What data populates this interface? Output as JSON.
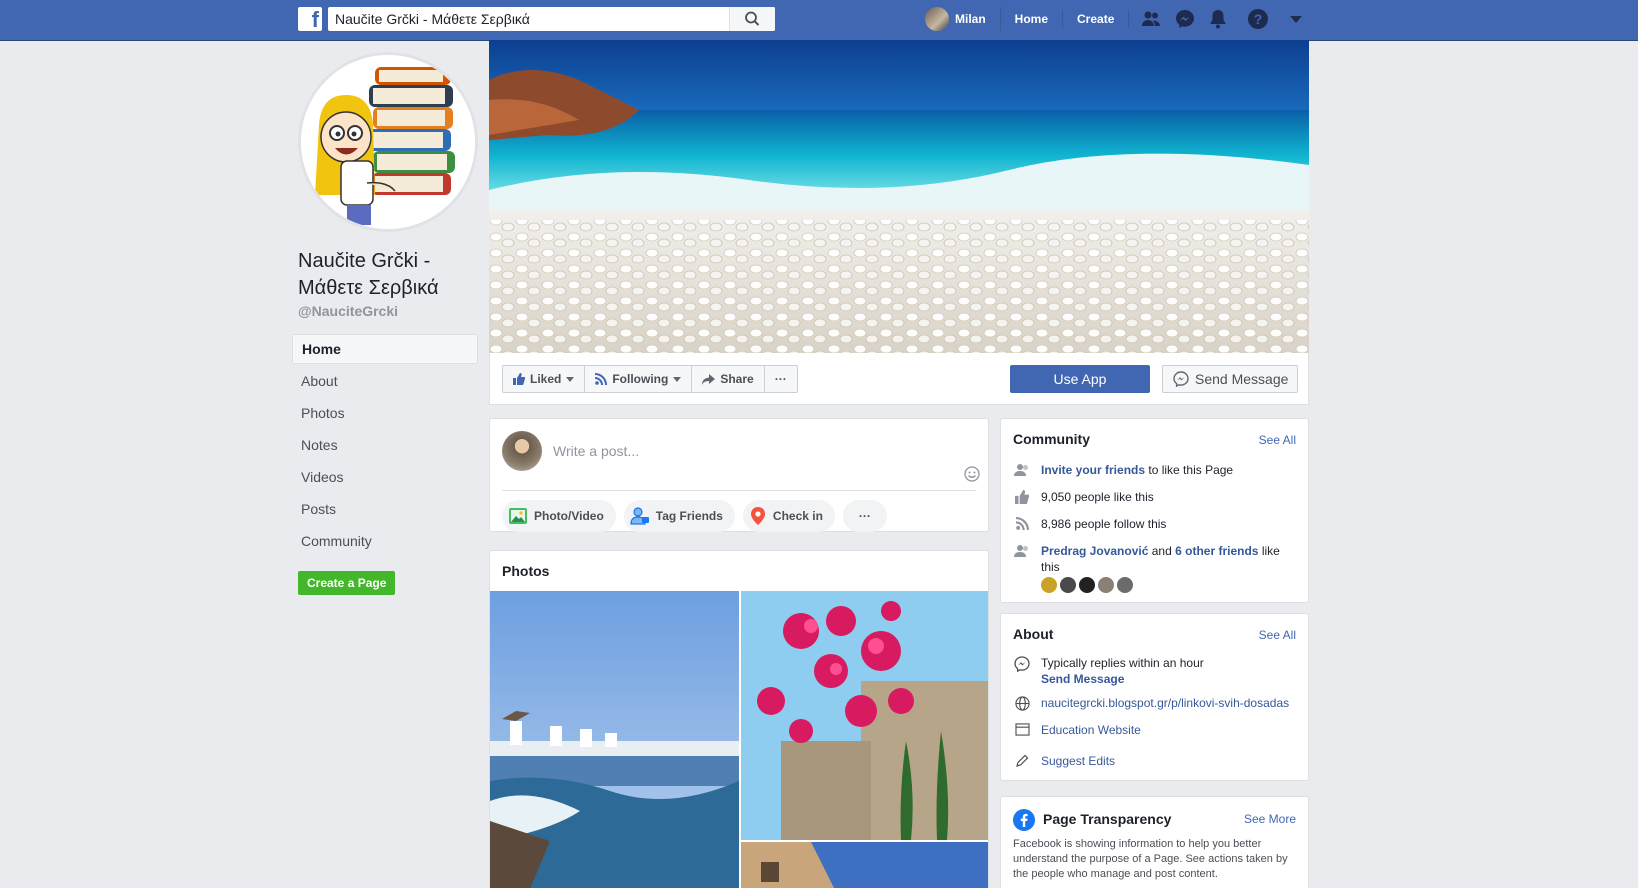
{
  "topbar": {
    "logo": "f",
    "search_value": "Naučite Grčki - Μάθετε Σερβικά",
    "user_name": "Milan",
    "home": "Home",
    "create": "Create",
    "icons": [
      "friends-icon",
      "messenger-icon",
      "notifications-icon",
      "help-icon",
      "account-menu-icon"
    ]
  },
  "page": {
    "title": "Naučite Grčki - Μάθετε Σερβικά",
    "handle": "@NauciteGrcki"
  },
  "left_nav": [
    "Home",
    "About",
    "Photos",
    "Notes",
    "Videos",
    "Posts",
    "Community"
  ],
  "create_page": "Create a Page",
  "actions": {
    "liked": "Liked",
    "following": "Following",
    "share": "Share",
    "more": "···",
    "use_app": "Use App",
    "send_message": "Send Message"
  },
  "composer": {
    "placeholder": "Write a post...",
    "photo_video": "Photo/Video",
    "tag_friends": "Tag Friends",
    "check_in": "Check in",
    "more": "···"
  },
  "photos": {
    "title": "Photos"
  },
  "community": {
    "title": "Community",
    "see_all": "See All",
    "invite_link": "Invite your friends",
    "invite_rest": "to like this Page",
    "likes": "9,050 people like this",
    "follows": "8,986 people follow this",
    "friend_name": "Predrag Jovanović",
    "friends_and": "and",
    "friends_other": "6 other friends",
    "friends_rest": "like this"
  },
  "about": {
    "title": "About",
    "see_all": "See All",
    "replies": "Typically replies within an hour",
    "send_message": "Send Message",
    "website": "naucitegrcki.blogspot.gr/p/linkovi-svih-dosadas",
    "category": "Education Website",
    "suggest": "Suggest Edits"
  },
  "transparency": {
    "title": "Page Transparency",
    "see_more": "See More",
    "text": "Facebook is showing information to help you better understand the purpose of a Page. See actions taken by the people who manage and post content."
  },
  "colors": {
    "brand": "#4267b2",
    "link": "#365899",
    "green": "#42b72a",
    "background": "#e9ebee"
  }
}
